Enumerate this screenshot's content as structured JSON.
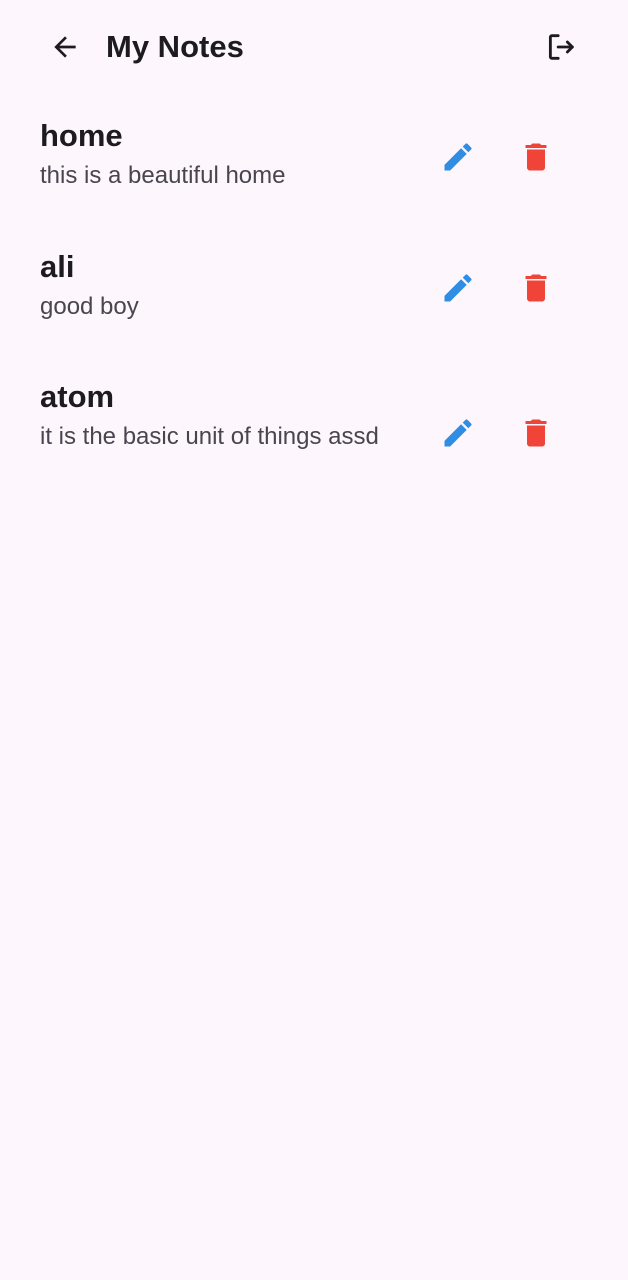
{
  "app_bar": {
    "title": "My Notes",
    "back_icon": "arrow-back-icon",
    "logout_icon": "logout-icon"
  },
  "colors": {
    "background": "#fdf7fd",
    "edit": "#2f8de4",
    "delete": "#f04438",
    "title_text": "#1d1b20",
    "body_text": "#49454f"
  },
  "notes": [
    {
      "title": "home",
      "body": "this is a beautiful home"
    },
    {
      "title": "ali",
      "body": "good boy"
    },
    {
      "title": "atom",
      "body": "it is the basic unit of things assd"
    }
  ]
}
